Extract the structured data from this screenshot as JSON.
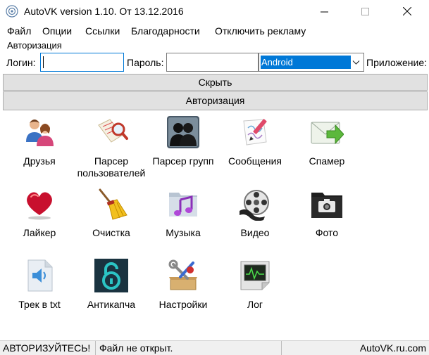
{
  "window": {
    "title": "AutoVK version 1.10. От 13.12.2016"
  },
  "menu": [
    "Файл",
    "Опции",
    "Ссылки",
    "Благодарности",
    "Отключить рекламу"
  ],
  "auth": {
    "group_label": "Авторизация",
    "login_label": "Логин:",
    "login_value": "",
    "password_label": "Пароль:",
    "password_value": "",
    "app_label": "Приложение:",
    "app_selected": "Android"
  },
  "buttons": {
    "hide": "Скрыть",
    "authorize": "Авторизация"
  },
  "tiles": [
    {
      "label": "Друзья",
      "icon": "friends-icon"
    },
    {
      "label": "Парсер пользователей",
      "icon": "user-parser-icon"
    },
    {
      "label": "Парсер групп",
      "icon": "group-parser-icon"
    },
    {
      "label": "Сообщения",
      "icon": "messages-icon"
    },
    {
      "label": "Спамер",
      "icon": "spammer-icon"
    },
    {
      "label": "Лайкер",
      "icon": "liker-icon"
    },
    {
      "label": "Очистка",
      "icon": "cleanup-icon"
    },
    {
      "label": "Музыка",
      "icon": "music-icon"
    },
    {
      "label": "Видео",
      "icon": "video-icon"
    },
    {
      "label": "Фото",
      "icon": "photo-icon"
    },
    {
      "label": "Трек в txt",
      "icon": "track-to-txt-icon"
    },
    {
      "label": "Антикапча",
      "icon": "anticaptcha-icon"
    },
    {
      "label": "Настройки",
      "icon": "settings-icon"
    },
    {
      "label": "Лог",
      "icon": "log-icon"
    }
  ],
  "status": {
    "auth_state": "АВТОРИЗУЙТЕСЬ!",
    "file_state": "Файл не открыт.",
    "site": "AutoVK.ru.com"
  },
  "colors": {
    "accent": "#0078d7",
    "button_face": "#e1e1e1",
    "statusbar": "#f0f0f0"
  }
}
